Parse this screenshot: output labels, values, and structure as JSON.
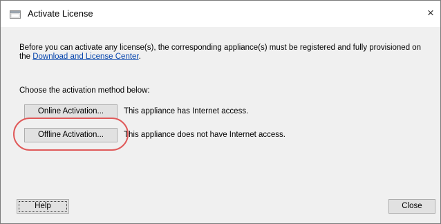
{
  "window": {
    "title": "Activate License",
    "close_symbol": "×"
  },
  "intro": {
    "text": "Before you can activate any license(s), the corresponding appliance(s) must be registered and fully provisioned on the ",
    "link": "Download and License Center",
    "suffix": "."
  },
  "method": {
    "prompt": "Choose the activation method below:",
    "online": {
      "button_label": "Online Activation...",
      "description": "This appliance has Internet access."
    },
    "offline": {
      "button_label": "Offline Activation...",
      "description": "This appliance does not have Internet access."
    }
  },
  "footer": {
    "help_label": "Help",
    "close_label": "Close"
  },
  "colors": {
    "highlight": "#e05a5a",
    "link": "#0645ad",
    "button_face": "#e1e1e1",
    "dialog_bg": "#f0f0f0"
  },
  "icons": {
    "title": "dialog-window-icon",
    "close": "close-icon"
  }
}
